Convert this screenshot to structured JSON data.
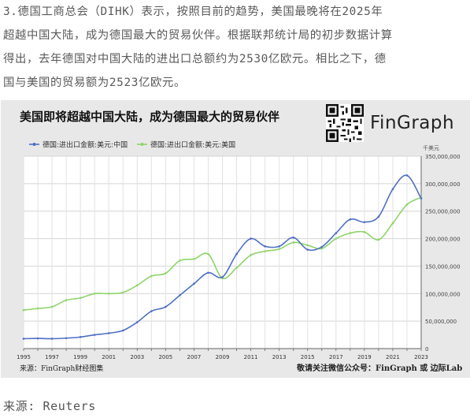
{
  "article": {
    "lines": [
      "3.德国工商总会（DIHK）表示，按照目前的趋势，美国最晚将在2025年",
      "超越中国大陆，成为德国最大的贸易伙伴。根据联邦统计局的初步数据计算",
      "得出，去年德国对中国大陆的进出口总额约为2530亿欧元。相比之下，德",
      "国与美国的贸易额为2523亿欧元。"
    ],
    "source": "来源: Reuters"
  },
  "figure": {
    "title": "美国即将超越中国大陆，成为德国最大的贸易伙伴",
    "brand": "FinGraph",
    "footer_left": "来源：FinGraph财经图集",
    "footer_right": "敬请关注微信公众号：FinGraph 或 边际Lab",
    "qr_icon": "qr-code-icon"
  },
  "chart_data": {
    "type": "line",
    "unit_label": "千美元",
    "x": [
      1995,
      1996,
      1997,
      1998,
      1999,
      2000,
      2001,
      2002,
      2003,
      2004,
      2005,
      2006,
      2007,
      2008,
      2009,
      2010,
      2011,
      2012,
      2013,
      2014,
      2015,
      2016,
      2017,
      2018,
      2019,
      2020,
      2021,
      2022,
      2023
    ],
    "x_tick_labels": [
      "1995",
      "1997",
      "1999",
      "2001",
      "2003",
      "2005",
      "2007",
      "2009",
      "2011",
      "2013",
      "2015",
      "2017",
      "2019",
      "2021",
      "2023"
    ],
    "ylim": [
      0,
      350000000
    ],
    "y_ticks": [
      0,
      50000000,
      100000000,
      150000000,
      200000000,
      250000000,
      300000000,
      350000000
    ],
    "y_tick_labels": [
      "0",
      "50,000,000",
      "100,000,000",
      "150,000,000",
      "200,000,000",
      "250,000,000",
      "300,000,000",
      "350,000,000"
    ],
    "grid": true,
    "legend_position": "top-left",
    "series": [
      {
        "name": "德国:进出口金额:美元:中国",
        "color": "#4f6fc4",
        "values": [
          18000000,
          18500000,
          18000000,
          19000000,
          21000000,
          25000000,
          28000000,
          33000000,
          48000000,
          68000000,
          76000000,
          97000000,
          118000000,
          138000000,
          130000000,
          172000000,
          200000000,
          186000000,
          186000000,
          202000000,
          180000000,
          185000000,
          210000000,
          235000000,
          230000000,
          240000000,
          290000000,
          315000000,
          273000000
        ]
      },
      {
        "name": "德国:进出口金额:美元:美国",
        "color": "#8fd46a",
        "values": [
          70000000,
          73000000,
          76000000,
          88000000,
          92000000,
          100000000,
          100000000,
          102000000,
          115000000,
          132000000,
          137000000,
          160000000,
          163000000,
          172000000,
          128000000,
          147000000,
          170000000,
          177000000,
          181000000,
          193000000,
          188000000,
          182000000,
          200000000,
          210000000,
          212000000,
          198000000,
          228000000,
          262000000,
          275000000
        ]
      }
    ]
  }
}
